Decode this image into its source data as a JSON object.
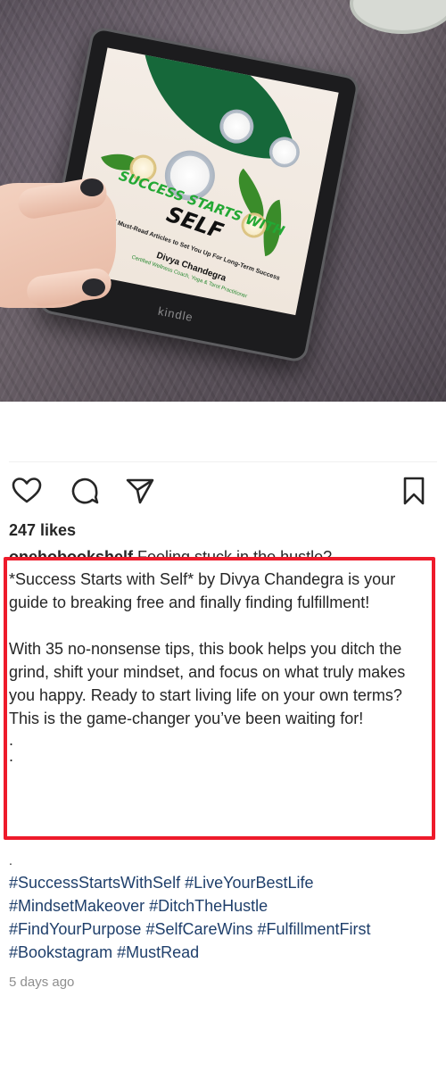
{
  "post": {
    "image": {
      "description_icon": "kindle-tablet-photo",
      "book_title_line1": "SUCCESS STARTS WITH",
      "book_title_line2": "SELF",
      "book_subtitle": "35 Must-Read Articles to Set You Up For Long-Term Success",
      "book_author": "Divya Chandegra",
      "book_credentials": "Certified Wellness Coach, Yoga & Tarot Practitioner",
      "device_label": "kindle"
    },
    "actions": {
      "like_icon": "heart-outline-icon",
      "comment_icon": "comment-bubble-icon",
      "share_icon": "paper-plane-icon",
      "save_icon": "bookmark-outline-icon"
    },
    "likes_text": "247 likes",
    "caption_peek": {
      "username": "onehobookshelf",
      "text": " Feeling stuck in the hustle?"
    },
    "caption": {
      "paragraph1": "*Success Starts with Self* by Divya Chandegra is your guide to breaking free and finally finding fulfillment!",
      "paragraph2": "With 35 no-nonsense tips, this book helps you ditch the grind, shift your mindset, and focus on what truly makes you happy. Ready to start living life on your own terms? This is the game-changer you’ve been waiting for!",
      "dot1": ".",
      "dot2": ".",
      "dot3": "."
    },
    "hashtags": [
      "#SuccessStartsWithSelf",
      "#LiveYourBestLife",
      "#MindsetMakeover",
      "#DitchTheHustle",
      "#FindYourPurpose",
      "#SelfCareWins",
      "#FulfillmentFirst",
      "#Bookstagram",
      "#MustRead"
    ],
    "timestamp": "5 days ago"
  },
  "colors": {
    "highlight_border": "#ee1b2b",
    "hashtag": "#1f3f6b",
    "timestamp": "#8e8e8e",
    "book_title_green": "#23a834"
  }
}
